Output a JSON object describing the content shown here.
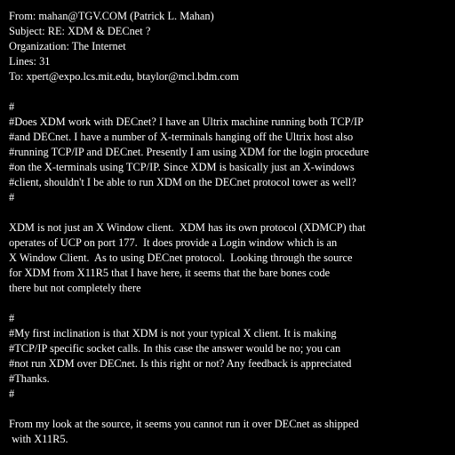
{
  "colors": {
    "background": "#000000",
    "text": "#ffffff"
  },
  "header": {
    "from": "From: mahan@TGV.COM (Patrick L. Mahan)",
    "subject": "Subject: RE: XDM & DECnet ?",
    "organization": "Organization: The Internet",
    "lines": "Lines: 31",
    "to": "To: xpert@expo.lcs.mit.edu, btaylor@mcl.bdm.com"
  },
  "quoted_question": [
    "#",
    "#Does XDM work with DECnet? I have an Ultrix machine running both TCP/IP",
    "#and DECnet. I have a number of X-terminals hanging off the Ultrix host also",
    "#running TCP/IP and DECnet. Presently I am using XDM for the login procedure",
    "#on the X-terminals using TCP/IP. Since XDM is basically just an X-windows",
    "#client, shouldn't I be able to run XDM on the DECnet protocol tower as well?",
    "#"
  ],
  "reply_1": [
    "XDM is not just an X Window client.  XDM has its own protocol (XDMCP) that",
    "operates of UCP on port 177.  It does provide a Login window which is an",
    "X Window Client.  As to using DECnet protocol.  Looking through the source",
    "for XDM from X11R5 that I have here, it seems that the bare bones code",
    "there but not completely there"
  ],
  "quoted_followup": [
    "#",
    "#My first inclination is that XDM is not your typical X client. It is making",
    "#TCP/IP specific socket calls. In this case the answer would be no; you can",
    "#not run XDM over DECnet. Is this right or not? Any feedback is appreciated",
    "#Thanks.",
    "#"
  ],
  "reply_2": [
    "From my look at the source, it seems you cannot run it over DECnet as shipped",
    " with X11R5."
  ]
}
